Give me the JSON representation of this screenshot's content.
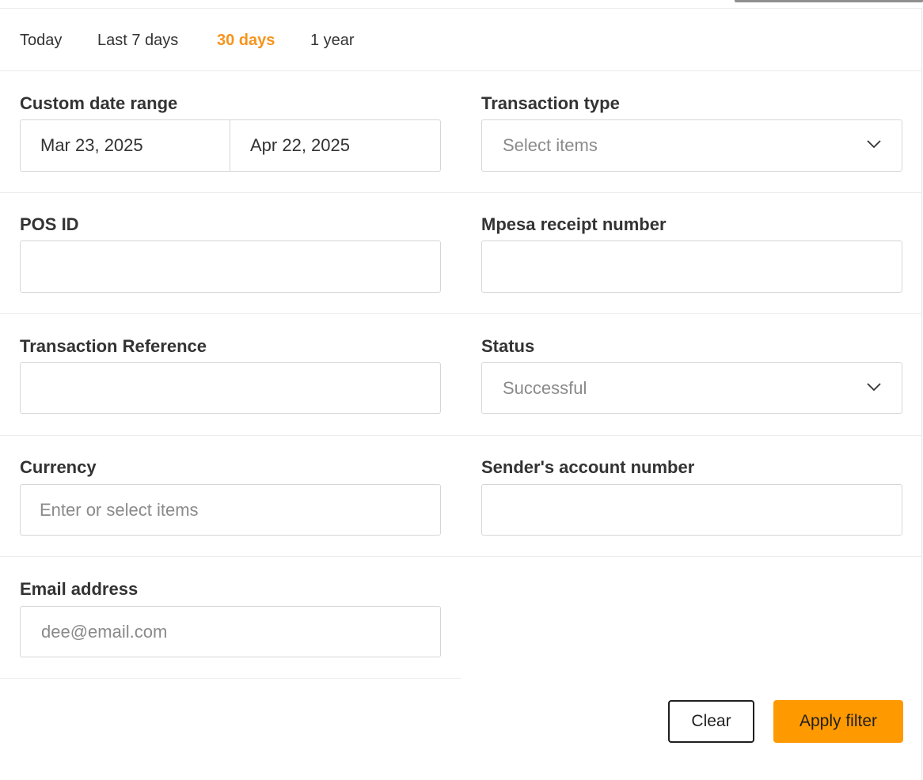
{
  "date_range_tabs": [
    {
      "label": "Today",
      "active": false
    },
    {
      "label": "Last 7 days",
      "active": false
    },
    {
      "label": "30 days",
      "active": true
    },
    {
      "label": "1 year",
      "active": false
    }
  ],
  "accent_color": "#f7941d",
  "button_color": "#ff9900",
  "fields": {
    "custom_date_range": {
      "label": "Custom date range",
      "start": "Mar 23, 2025",
      "end": "Apr 22, 2025"
    },
    "transaction_type": {
      "label": "Transaction type",
      "placeholder": "Select items",
      "icon": "chevron-down-icon"
    },
    "pos_id": {
      "label": "POS ID",
      "value": ""
    },
    "mpesa_receipt_number": {
      "label": "Mpesa receipt number",
      "value": ""
    },
    "transaction_reference": {
      "label": "Transaction Reference",
      "value": ""
    },
    "status": {
      "label": "Status",
      "value": "Successful",
      "icon": "chevron-down-icon"
    },
    "currency": {
      "label": "Currency",
      "placeholder": "Enter or select items"
    },
    "senders_account_number": {
      "label": "Sender's account number",
      "value": ""
    },
    "email_address": {
      "label": "Email address",
      "placeholder": "dee@email.com"
    }
  },
  "actions": {
    "clear_label": "Clear",
    "apply_label": "Apply filter"
  }
}
